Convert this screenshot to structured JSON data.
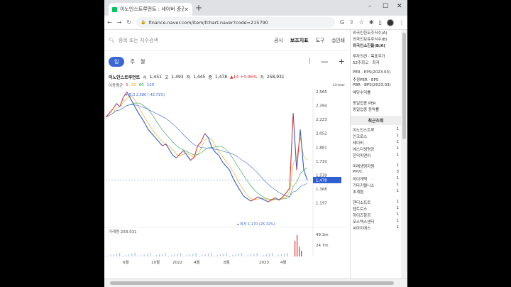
{
  "browser": {
    "tab_title": "이노인스트루먼트 : 네이버 증권",
    "url": "finance.naver.com/item/fchart.naver?code=215790"
  },
  "toolbar": {
    "search_placeholder": "종목 또는 지수검색",
    "links": [
      "공시",
      "보조지표",
      "도구",
      "인쇄"
    ]
  },
  "period": {
    "tabs": [
      "일",
      "주",
      "월"
    ],
    "active": "일"
  },
  "info": {
    "name": "이노인스트루먼트",
    "open_label": "시",
    "open": "1,451",
    "high_label": "고",
    "high": "1,493",
    "low_label": "저",
    "low": "1,445",
    "close_label": "종",
    "close": "1,478",
    "change": "▲14 +0.96%",
    "vol_label": "거",
    "volume": "258,931"
  },
  "ma": {
    "label": "이동평균",
    "periods": [
      "5",
      "20",
      "60",
      "120"
    ]
  },
  "scale_label": "Linear",
  "volume_label": "거래량",
  "volume_value": "258,931",
  "chart_data": {
    "type": "line",
    "price_ticks": [
      "2,565",
      "2,394",
      "2,223",
      "2,052",
      "1,881",
      "1,710",
      "1,539",
      "1,368",
      "1,197"
    ],
    "current_price": "1,478",
    "high_marker": "최고 2,580 (-42.71%)",
    "low_marker": "최저 1,170 (26.32%)",
    "x_labels": [
      "6월",
      "10월",
      "2022",
      "4월",
      "8월",
      "2023",
      "4월"
    ],
    "volume_ticks": [
      "49.3m",
      "24.7m"
    ],
    "price": [
      2250,
      2300,
      2350,
      2420,
      2380,
      2500,
      2560,
      2480,
      2400,
      2320,
      2250,
      2180,
      2100,
      2050,
      2000,
      1950,
      1900,
      1920,
      1850,
      1780,
      1750,
      1800,
      1840,
      1780,
      1720,
      1760,
      1900,
      1950,
      2050,
      2000,
      1880,
      1820,
      1780,
      1700,
      1650,
      1600,
      1500,
      1420,
      1350,
      1280,
      1250,
      1220,
      1240,
      1270,
      1250,
      1230,
      1210,
      1240,
      1260,
      1230,
      1270,
      1320,
      1380,
      2300,
      1600,
      2100,
      1600,
      1478
    ]
  },
  "side": {
    "top_rows": [
      "외국인한도주식수(A)",
      "외국인보유주식수(B)",
      "외국인소진율(B/A)",
      "투자의견 · 목표주가",
      "52주최고 · 최저",
      "PER · EPS(2023.03)",
      "추정PER · EPS",
      "PBR · BPS(2023.03)",
      "배당수익률",
      "동일업종 PER",
      "동일업종 등락률"
    ],
    "recent_title": "최근조회",
    "recent": [
      "이노인스트루",
      "인크로스",
      "제이비",
      "에스디생명공",
      "한익피엔이",
      "미래생명자원",
      "PPI/C",
      "라이게텍",
      "기타키텔니스",
      "초계협",
      "핸디소프트",
      "텝트로스",
      "하이즈항공",
      "포스텍스센터",
      "씨아이에스"
    ],
    "recent_counts": [
      "1",
      "1",
      "2",
      "1",
      "1",
      "1",
      "3",
      "1",
      "1",
      "1",
      "1",
      "1",
      "1",
      "1",
      "1"
    ]
  }
}
